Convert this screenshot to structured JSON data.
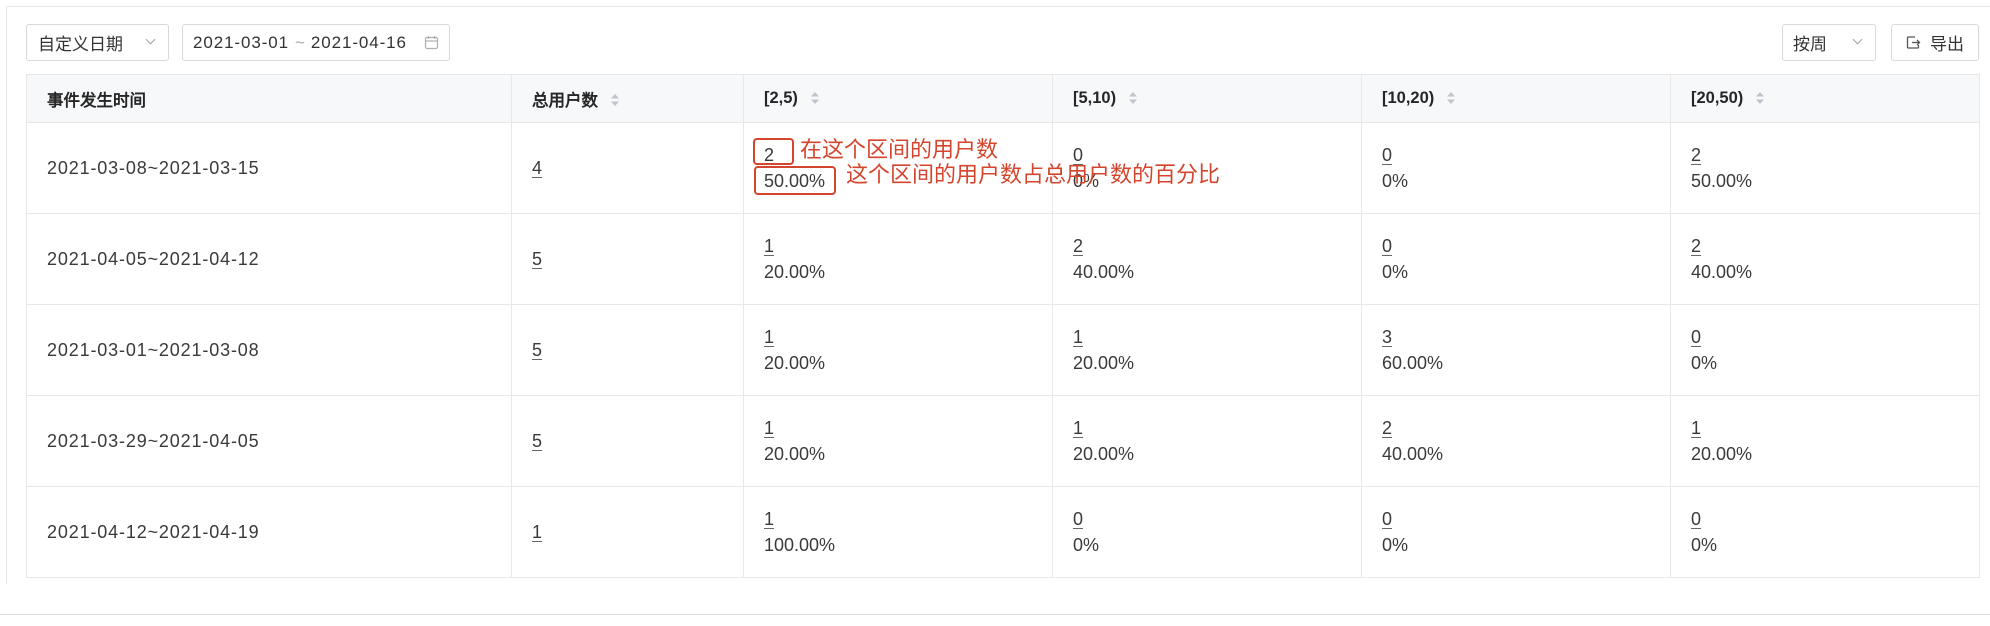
{
  "toolbar": {
    "date_preset": "自定义日期",
    "date_range": {
      "start": "2021-03-01",
      "separator": "~",
      "end": "2021-04-16"
    },
    "granularity": "按周",
    "export_label": "导出"
  },
  "table": {
    "columns": [
      "事件发生时间",
      "总用户数",
      "[2,5)",
      "[5,10)",
      "[10,20)",
      "[20,50)"
    ],
    "rows": [
      {
        "time": "2021-03-08~2021-03-15",
        "total": "4",
        "buckets": [
          {
            "count": "2",
            "pct": "50.00%"
          },
          {
            "count": "0",
            "pct": "0%"
          },
          {
            "count": "0",
            "pct": "0%"
          },
          {
            "count": "2",
            "pct": "50.00%"
          }
        ]
      },
      {
        "time": "2021-04-05~2021-04-12",
        "total": "5",
        "buckets": [
          {
            "count": "1",
            "pct": "20.00%"
          },
          {
            "count": "2",
            "pct": "40.00%"
          },
          {
            "count": "0",
            "pct": "0%"
          },
          {
            "count": "2",
            "pct": "40.00%"
          }
        ]
      },
      {
        "time": "2021-03-01~2021-03-08",
        "total": "5",
        "buckets": [
          {
            "count": "1",
            "pct": "20.00%"
          },
          {
            "count": "1",
            "pct": "20.00%"
          },
          {
            "count": "3",
            "pct": "60.00%"
          },
          {
            "count": "0",
            "pct": "0%"
          }
        ]
      },
      {
        "time": "2021-03-29~2021-04-05",
        "total": "5",
        "buckets": [
          {
            "count": "1",
            "pct": "20.00%"
          },
          {
            "count": "1",
            "pct": "20.00%"
          },
          {
            "count": "2",
            "pct": "40.00%"
          },
          {
            "count": "1",
            "pct": "20.00%"
          }
        ]
      },
      {
        "time": "2021-04-12~2021-04-19",
        "total": "1",
        "buckets": [
          {
            "count": "1",
            "pct": "100.00%"
          },
          {
            "count": "0",
            "pct": "0%"
          },
          {
            "count": "0",
            "pct": "0%"
          },
          {
            "count": "0",
            "pct": "0%"
          }
        ]
      }
    ]
  },
  "annotations": {
    "count_note": "在这个区间的用户数",
    "pct_note": "这个区间的用户数占总用户数的百分比"
  },
  "icons": [
    "chevron-down-icon",
    "calendar-icon",
    "export-icon",
    "sort-icon"
  ],
  "colors": {
    "annotation": "#d4452e",
    "header_bg": "#f7f8fa",
    "border": "#e8e8e8",
    "text": "#333333"
  }
}
